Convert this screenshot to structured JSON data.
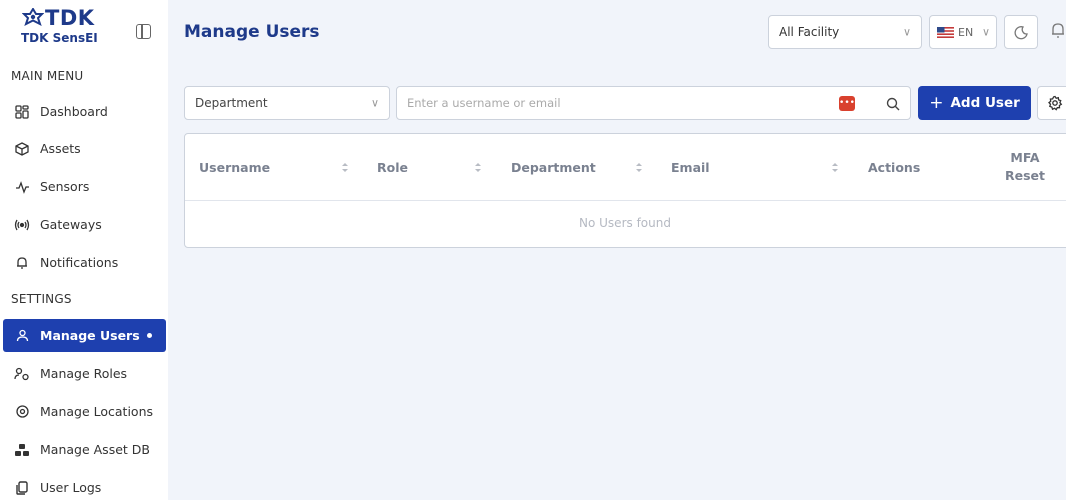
{
  "brand": {
    "logo_text": "TDK",
    "product_name": "TDK SensEI"
  },
  "sidebar": {
    "main_menu_label": "MAIN MENU",
    "settings_label": "SETTINGS",
    "main_items": [
      {
        "label": "Dashboard",
        "icon": "dashboard-icon"
      },
      {
        "label": "Assets",
        "icon": "cube-icon"
      },
      {
        "label": "Sensors",
        "icon": "pulse-icon"
      },
      {
        "label": "Gateways",
        "icon": "broadcast-icon"
      },
      {
        "label": "Notifications",
        "icon": "bell-icon"
      }
    ],
    "settings_items": [
      {
        "label": "Manage Users",
        "icon": "user-icon",
        "active": true
      },
      {
        "label": "Manage Roles",
        "icon": "roles-icon"
      },
      {
        "label": "Manage Locations",
        "icon": "location-pin-icon"
      },
      {
        "label": "Manage Asset DB",
        "icon": "cubes-icon"
      },
      {
        "label": "User Logs",
        "icon": "document-icon"
      }
    ]
  },
  "header": {
    "title": "Manage Users",
    "facility_value": "All Facility",
    "language_value": "EN"
  },
  "toolbar": {
    "department_value": "Department",
    "search_placeholder": "Enter a username or email",
    "add_user_label": "Add User",
    "add_user_plus": "+"
  },
  "table": {
    "columns": {
      "username": "Username",
      "role": "Role",
      "department": "Department",
      "email": "Email",
      "actions": "Actions",
      "mfa_line1": "MFA",
      "mfa_line2": "Reset"
    },
    "empty_message": "No Users found"
  },
  "colors": {
    "primary": "#1e40af",
    "title": "#1e3a8a",
    "background": "#f1f4fa"
  }
}
